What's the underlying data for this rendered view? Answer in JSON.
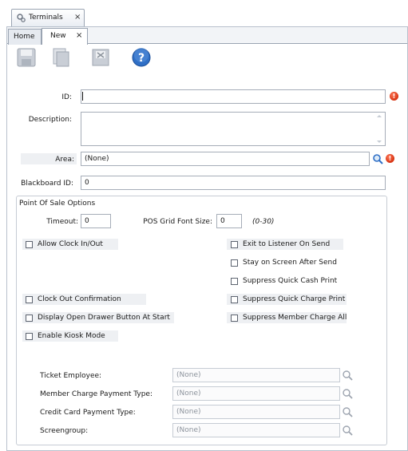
{
  "window_tab": {
    "title": "Terminals",
    "close": "×"
  },
  "subtabs": [
    {
      "label": "Home"
    },
    {
      "label": "New",
      "close": "×"
    }
  ],
  "toolbar": {
    "icons": [
      "save-icon",
      "copy-icon",
      "delete-icon",
      "help-icon"
    ]
  },
  "form": {
    "id_label": "ID:",
    "id_value": "",
    "description_label": "Description:",
    "description_value": "",
    "area_label": "Area:",
    "area_value": "(None)",
    "blackboard_label": "Blackboard ID:",
    "blackboard_value": "0",
    "error_glyph": "!"
  },
  "pos": {
    "title": "Point Of Sale Options",
    "timeout_label": "Timeout:",
    "timeout_value": "0",
    "font_size_label": "POS Grid Font Size:",
    "font_size_value": "0",
    "font_size_hint": "(0-30)",
    "checkboxes": {
      "allow_clock": "Allow Clock In/Out",
      "exit_listener": "Exit to Listener On Send",
      "stay_on_screen": "Stay on Screen After Send",
      "suppress_cash": "Suppress Quick Cash Print",
      "clock_out_confirm": "Clock Out Confirmation",
      "suppress_charge": "Suppress Quick Charge Print",
      "display_drawer": "Display Open Drawer Button At Start",
      "suppress_member": "Suppress Member Charge All",
      "kiosk": "Enable Kiosk Mode"
    },
    "lookups": [
      {
        "label": "Ticket Employee:",
        "value": "(None)"
      },
      {
        "label": "Member Charge Payment Type:",
        "value": "(None)"
      },
      {
        "label": "Credit Card Payment Type:",
        "value": "(None)"
      },
      {
        "label": "Screengroup:",
        "value": "(None)"
      }
    ]
  },
  "colors": {
    "accent": "#2f6fc6",
    "error": "#d6300f",
    "border": "#a6adb8"
  }
}
